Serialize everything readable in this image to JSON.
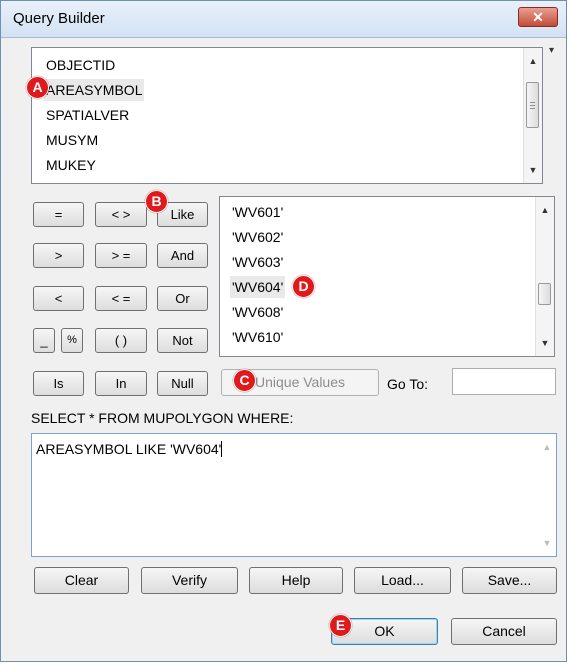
{
  "window": {
    "title": "Query Builder",
    "close_glyph": "✕"
  },
  "fields": {
    "items": [
      "OBJECTID",
      "AREASYMBOL",
      "SPATIALVER",
      "MUSYM",
      "MUKEY"
    ],
    "selected": "AREASYMBOL"
  },
  "pin_glyph": "▾",
  "scroll": {
    "up": "▲",
    "down": "▼"
  },
  "operators": {
    "eq": "=",
    "ne": "< >",
    "like": "Like",
    "gt": ">",
    "ge": "> =",
    "and": "And",
    "lt": "<",
    "le": "< =",
    "or": "Or",
    "underscore": "_",
    "percent": "%",
    "parens": "( )",
    "not": "Not",
    "is": "Is",
    "in": "In",
    "null": "Null"
  },
  "values": {
    "items": [
      "'WV601'",
      "'WV602'",
      "'WV603'",
      "'WV604'",
      "'WV608'",
      "'WV610'"
    ],
    "selected": "'WV604'"
  },
  "unique_values_label": "Unique Values",
  "goto": {
    "label": "Go To:",
    "value": ""
  },
  "sql": {
    "header": "SELECT * FROM MUPOLYGON WHERE:",
    "expression": "AREASYMBOL LIKE 'WV604'"
  },
  "actions": {
    "clear": "Clear",
    "verify": "Verify",
    "help": "Help",
    "load": "Load...",
    "save": "Save..."
  },
  "dialog": {
    "ok": "OK",
    "cancel": "Cancel"
  },
  "markers": {
    "a": "A",
    "b": "B",
    "c": "C",
    "d": "D",
    "e": "E"
  },
  "colors": {
    "marker": "#e0191d",
    "title_gradient": "#d2e2f4",
    "close_button": "#c44b38"
  }
}
